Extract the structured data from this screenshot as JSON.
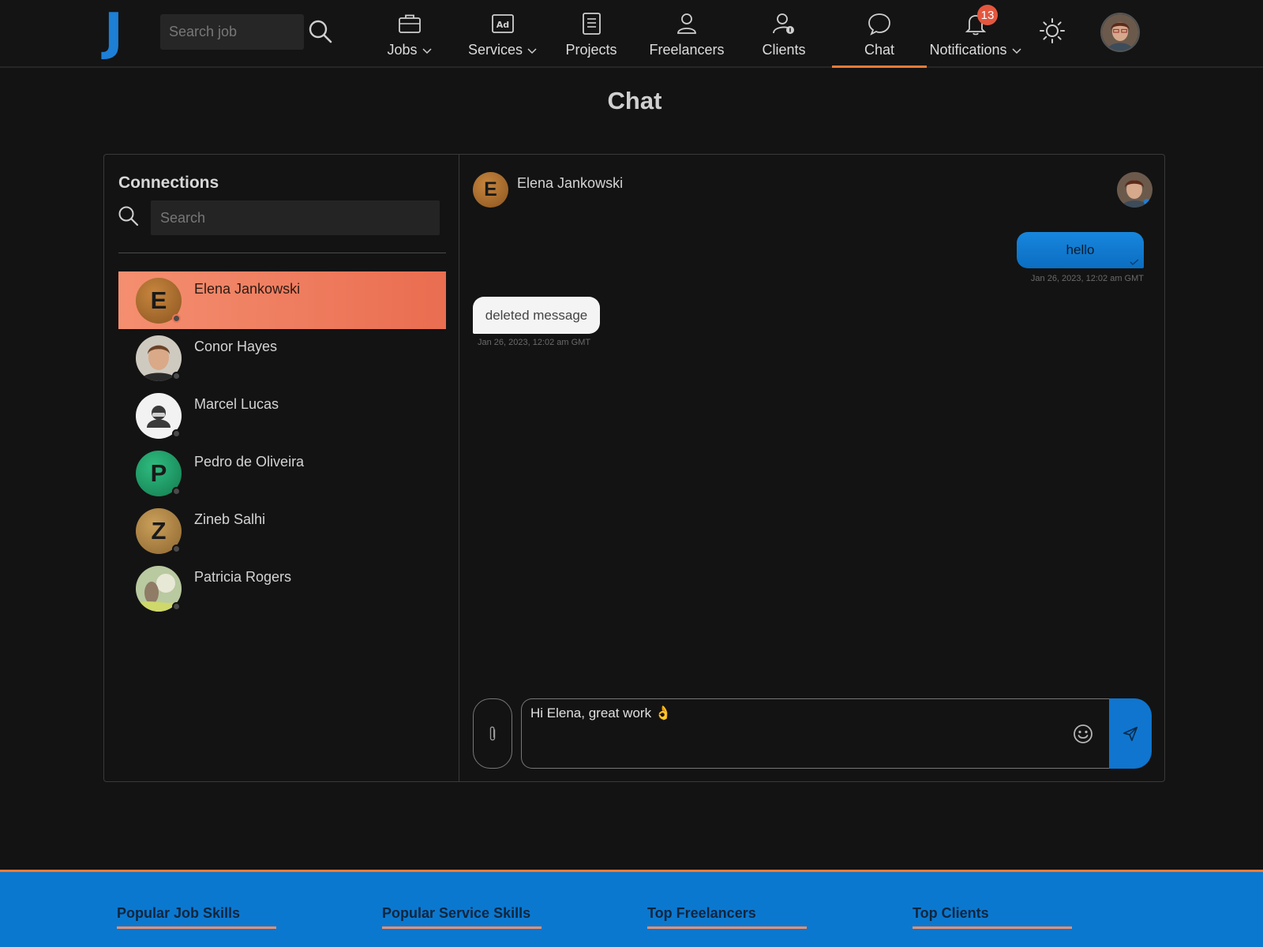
{
  "nav": {
    "logo": "J",
    "search_placeholder": "Search job",
    "items": [
      {
        "label": "Jobs",
        "icon": "briefcase-icon",
        "dropdown": true
      },
      {
        "label": "Services",
        "icon": "ad-icon",
        "dropdown": true
      },
      {
        "label": "Projects",
        "icon": "document-list-icon",
        "dropdown": false
      },
      {
        "label": "Freelancers",
        "icon": "person-icon",
        "dropdown": false
      },
      {
        "label": "Clients",
        "icon": "client-icon",
        "dropdown": false
      },
      {
        "label": "Chat",
        "icon": "chat-bubble-icon",
        "dropdown": false,
        "active": true
      },
      {
        "label": "Notifications",
        "icon": "bell-icon",
        "dropdown": true
      }
    ],
    "notification_count": "13",
    "theme_icon": "sun-icon"
  },
  "page": {
    "title": "Chat"
  },
  "connections": {
    "title": "Connections",
    "search_placeholder": "Search",
    "contacts": [
      {
        "name": "Elena Jankowski",
        "initial": "E",
        "avatar_color": "#a8692c",
        "active": true
      },
      {
        "name": "Conor Hayes",
        "initial": "",
        "avatar_color": "#c9a27e",
        "photo": true
      },
      {
        "name": "Marcel Lucas",
        "initial": "",
        "avatar_color": "#f2f2f2",
        "photo": true
      },
      {
        "name": "Pedro de Oliveira",
        "initial": "P",
        "avatar_color": "#1f9a66"
      },
      {
        "name": "Zineb Salhi",
        "initial": "Z",
        "avatar_color": "#b08540"
      },
      {
        "name": "Patricia Rogers",
        "initial": "",
        "avatar_color": "#9fb67a",
        "photo": true
      }
    ]
  },
  "conversation": {
    "contact_name": "Elena Jankowski",
    "contact_initial": "E",
    "messages": [
      {
        "direction": "outgoing",
        "text": "hello",
        "time": "Jan 26, 2023, 12:02 am GMT"
      },
      {
        "direction": "incoming",
        "text": "deleted message",
        "time": "Jan 26, 2023, 12:02 am GMT"
      }
    ],
    "draft": "Hi Elena, great work 👌"
  },
  "footer": {
    "columns": [
      "Popular Job Skills",
      "Popular Service Skills",
      "Top Freelancers",
      "Top Clients"
    ]
  },
  "colors": {
    "brand_blue": "#0b78d0",
    "accent_orange": "#f07a35",
    "active_contact": "#ea6d50",
    "badge": "#e4573f"
  }
}
